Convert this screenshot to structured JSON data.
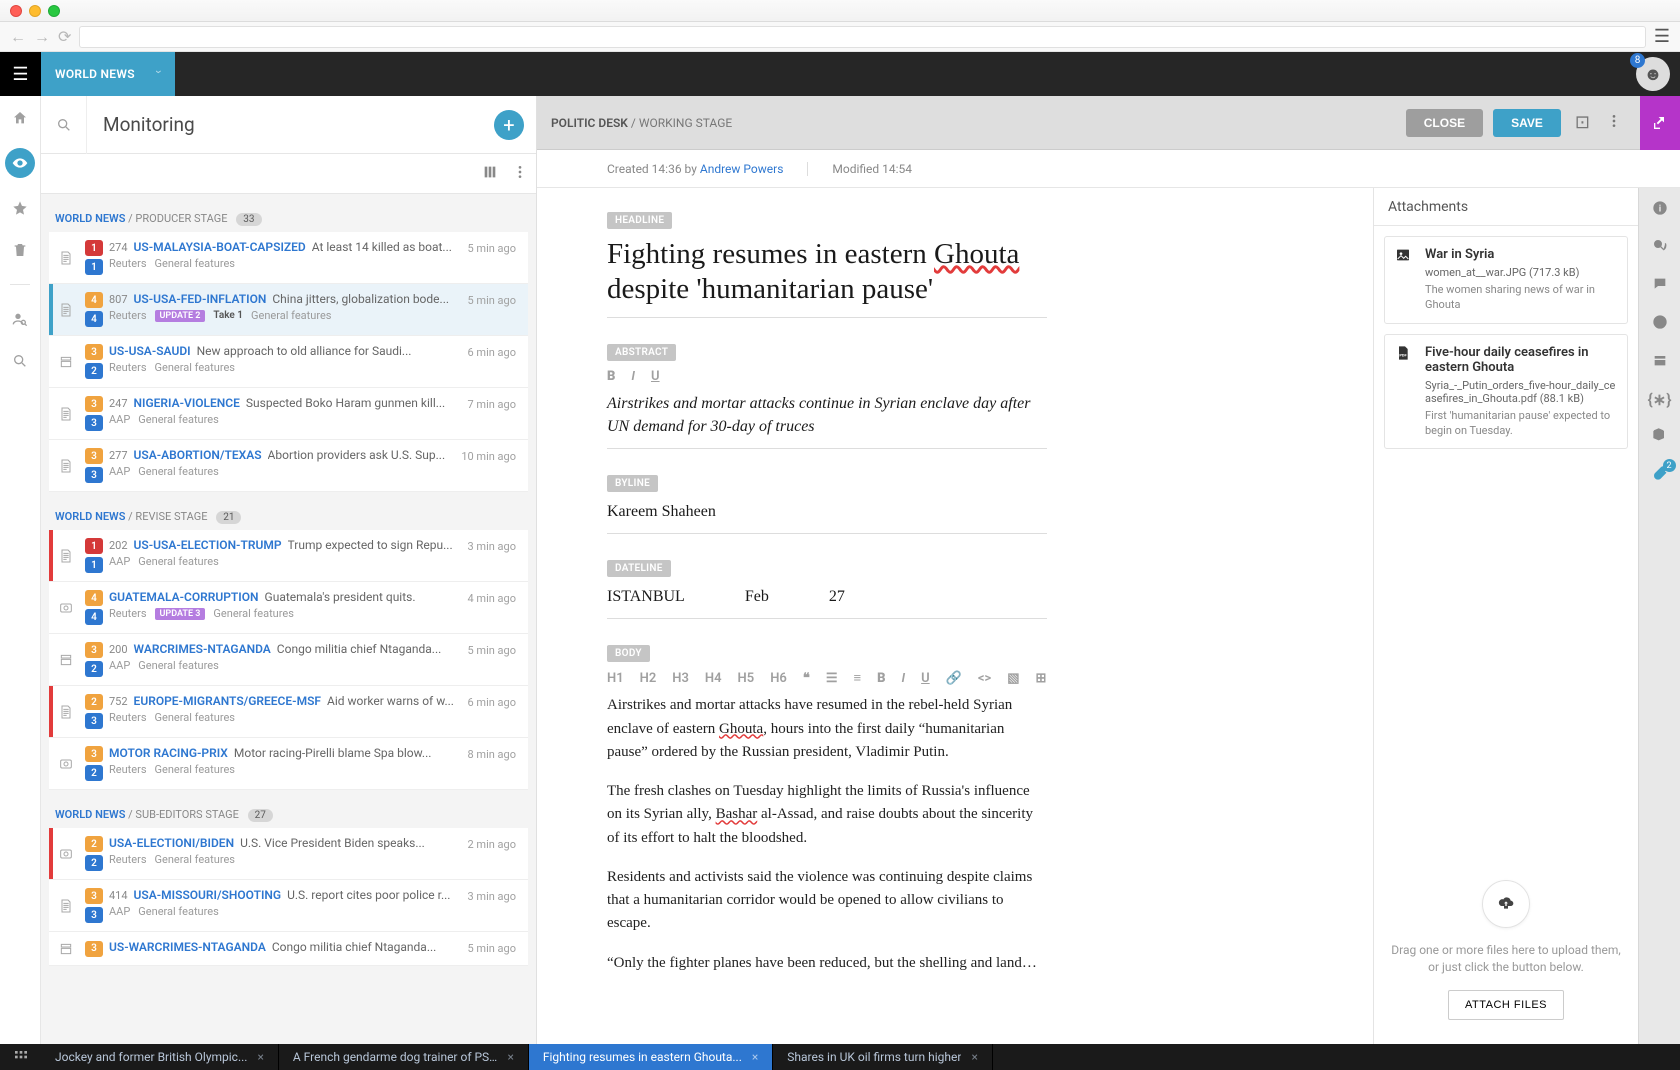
{
  "desk": "WORLD NEWS",
  "avatar_badge": "8",
  "monitor": {
    "title": "Monitoring",
    "stages": [
      {
        "desk": "WORLD NEWS",
        "stage": "PRODUCER STAGE",
        "count": "33",
        "items": [
          {
            "type": "text",
            "b1": "1",
            "b1c": "red",
            "b2": "1",
            "b2c": "blue",
            "wc": "274",
            "slug": "US-MALAYSIA-BOAT-CAPSIZED",
            "headline": "At least 14 killed as boat...",
            "src": "Reuters",
            "cat": "General features",
            "time": "5 min ago",
            "urgent": false,
            "selected": false
          },
          {
            "type": "text",
            "b1": "4",
            "b1c": "orange",
            "b2": "4",
            "b2c": "blue",
            "wc": "807",
            "slug": "US-USA-FED-INFLATION",
            "headline": "China jitters, globalization bode...",
            "src": "Reuters",
            "chip": "UPDATE 2",
            "take": "Take 1",
            "cat": "General features",
            "time": "5 min ago",
            "urgent": true,
            "selected": true
          },
          {
            "type": "pkg",
            "b1": "3",
            "b1c": "orange",
            "b2": "2",
            "b2c": "blue",
            "wc": "",
            "slug": "US-USA-SAUDI",
            "headline": "New approach to old alliance for Saudi...",
            "src": "Reuters",
            "cat": "General features",
            "time": "6 min ago",
            "urgent": false,
            "selected": false
          },
          {
            "type": "text",
            "b1": "3",
            "b1c": "orange",
            "b2": "3",
            "b2c": "blue",
            "wc": "247",
            "slug": "NIGERIA-VIOLENCE",
            "headline": "Suspected Boko Haram gunmen kill...",
            "src": "AAP",
            "cat": "General features",
            "time": "7 min ago",
            "urgent": false,
            "selected": false
          },
          {
            "type": "text",
            "b1": "3",
            "b1c": "orange",
            "b2": "3",
            "b2c": "blue",
            "wc": "277",
            "slug": "USA-ABORTION/TEXAS",
            "headline": "Abortion providers ask U.S. Sup...",
            "src": "AAP",
            "cat": "General features",
            "time": "10 min ago",
            "urgent": false,
            "selected": false
          }
        ]
      },
      {
        "desk": "WORLD NEWS",
        "stage": "REVISE STAGE",
        "count": "21",
        "items": [
          {
            "type": "text",
            "b1": "1",
            "b1c": "red",
            "b2": "1",
            "b2c": "blue",
            "wc": "202",
            "slug": "US-USA-ELECTION-TRUMP",
            "headline": "Trump expected to sign Repu...",
            "src": "AAP",
            "cat": "General features",
            "time": "3 min ago",
            "urgent": true,
            "selected": false
          },
          {
            "type": "photo",
            "b1": "4",
            "b1c": "orange",
            "b2": "4",
            "b2c": "blue",
            "wc": "",
            "slug": "GUATEMALA-CORRUPTION",
            "headline": "Guatemala's president quits.",
            "src": "Reuters",
            "chip": "UPDATE 3",
            "cat": "General features",
            "time": "4 min ago",
            "urgent": false,
            "selected": false
          },
          {
            "type": "pkg",
            "b1": "3",
            "b1c": "orange",
            "b2": "2",
            "b2c": "blue",
            "wc": "200",
            "slug": "WARCRIMES-NTAGANDA",
            "headline": "Congo militia chief Ntaganda...",
            "src": "AAP",
            "cat": "General features",
            "time": "5 min ago",
            "urgent": false,
            "selected": false
          },
          {
            "type": "text",
            "b1": "2",
            "b1c": "orange",
            "b2": "3",
            "b2c": "blue",
            "wc": "752",
            "slug": "EUROPE-MIGRANTS/GREECE-MSF",
            "headline": "Aid worker warns of w...",
            "src": "Reuters",
            "cat": "General features",
            "time": "6 min ago",
            "urgent": true,
            "selected": false
          },
          {
            "type": "photo",
            "b1": "3",
            "b1c": "orange",
            "b2": "2",
            "b2c": "blue",
            "wc": "",
            "slug": "MOTOR RACING-PRIX",
            "headline": "Motor racing-Pirelli blame Spa blow...",
            "src": "Reuters",
            "cat": "General features",
            "time": "8 min ago",
            "urgent": false,
            "selected": false
          }
        ]
      },
      {
        "desk": "WORLD NEWS",
        "stage": "SUB-EDITORS STAGE",
        "count": "27",
        "items": [
          {
            "type": "photo",
            "b1": "2",
            "b1c": "orange",
            "b2": "2",
            "b2c": "blue",
            "wc": "",
            "slug": "USA-ELECTIONI/BIDEN",
            "headline": "U.S. Vice President Biden speaks...",
            "src": "Reuters",
            "cat": "General features",
            "time": "2 min ago",
            "urgent": true,
            "selected": false
          },
          {
            "type": "text",
            "b1": "3",
            "b1c": "orange",
            "b2": "3",
            "b2c": "blue",
            "wc": "414",
            "slug": "USA-MISSOURI/SHOOTING",
            "headline": "U.S. report cites poor police r...",
            "src": "AAP",
            "cat": "General features",
            "time": "3 min ago",
            "urgent": false,
            "selected": false
          },
          {
            "type": "pkg",
            "b1": "3",
            "b1c": "orange",
            "b2": "",
            "b2c": "",
            "wc": "",
            "slug": "US-WARCRIMES-NTAGANDA",
            "headline": "Congo militia chief Ntaganda...",
            "src": "",
            "cat": "",
            "time": "5 min ago",
            "urgent": false,
            "selected": false
          }
        ]
      }
    ]
  },
  "editor": {
    "crumb_desk": "POLITIC DESK",
    "crumb_stage": "WORKING STAGE",
    "close": "CLOSE",
    "save": "SAVE",
    "meta_created": "Created 14:36 by ",
    "meta_author": "Andrew Powers",
    "meta_modified": "Modified 14:54",
    "labels": {
      "headline": "HEADLINE",
      "abstract": "ABSTRACT",
      "byline": "BYLINE",
      "dateline": "DATELINE",
      "body": "BODY"
    },
    "headline": "Fighting resumes in eastern Ghouta despite 'humanitarian pause'",
    "abstract": "Airstrikes and mortar attacks continue in Syrian enclave day after UN demand for 30-day of truces",
    "byline": "Kareem Shaheen",
    "dateline": {
      "city": "ISTANBUL",
      "month": "Feb",
      "day": "27"
    },
    "body_p1": "Airstrikes and mortar attacks have resumed in the rebel-held Syrian enclave of eastern Ghouta, hours into the first daily “humanitarian pause” ordered by the Russian president, Vladimir Putin.",
    "body_p2": "The fresh clashes on Tuesday highlight the limits of Russia's influence on its Syrian ally, Bashar al-Assad, and raise doubts about the sincerity of its effort to halt the bloodshed.",
    "body_p3": "Residents and activists said the violence was continuing despite claims that a humanitarian corridor would be opened to allow civilians to escape.",
    "body_p4": "“Only the fighter planes have been reduced, but the shelling and landing raids continue..."
  },
  "attachments": {
    "title": "Attachments",
    "items": [
      {
        "icon": "image",
        "title": "War in Syria",
        "file": "women_at__war.JPG (717.3 kB)",
        "desc": "The women sharing news of war in Ghouta"
      },
      {
        "icon": "pdf",
        "title": "Five-hour daily ceasefires in eastern Ghouta",
        "file": "Syria_-_Putin_orders_five-hour_daily_ceasefires_in_Ghouta.pdf  (88.1 kB)",
        "desc": "First 'humanitarian pause' expected to begin on Tuesday."
      }
    ],
    "drop_msg": "Drag one or more files here to upload them, or just click the button below.",
    "attach_btn": "ATTACH FILES"
  },
  "rrail_attach_badge": "2",
  "workspace": [
    {
      "label": "Jockey and former British Olympic...",
      "active": false
    },
    {
      "label": "A French gendarme dog trainer of PSIG",
      "active": false
    },
    {
      "label": "Fighting resumes in eastern Ghouta...",
      "active": true
    },
    {
      "label": "Shares in UK oil firms turn higher",
      "active": false
    }
  ]
}
